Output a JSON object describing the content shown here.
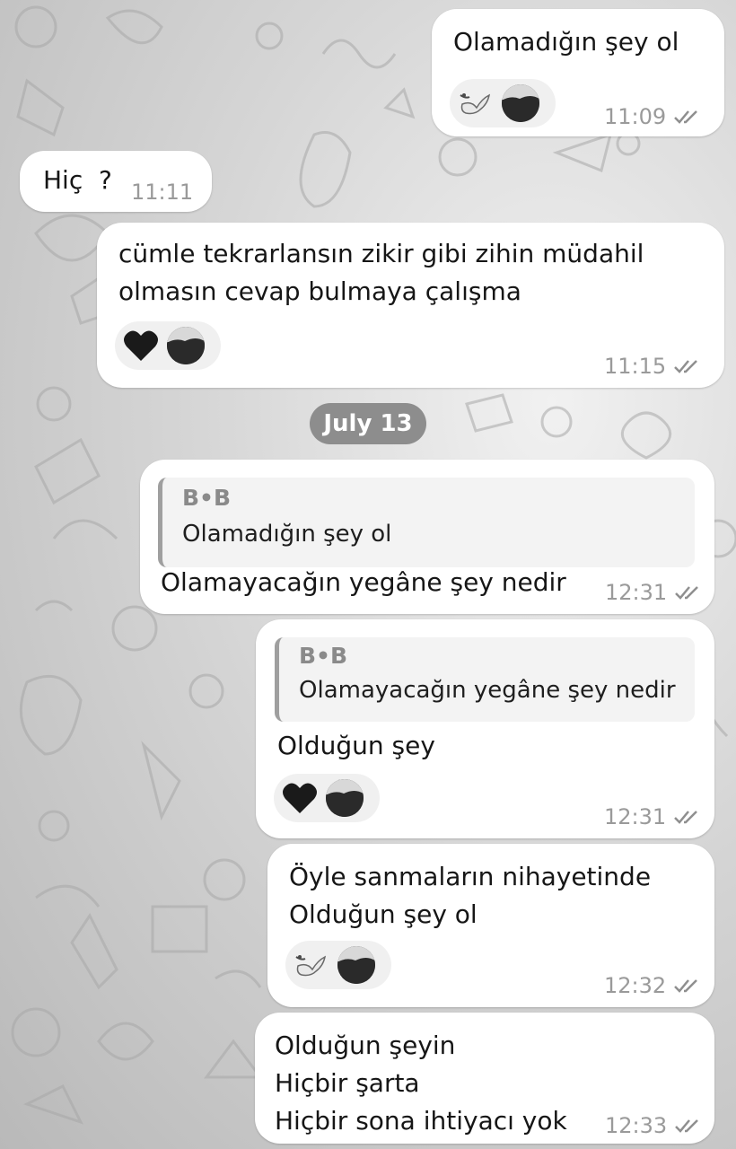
{
  "theme": {
    "bubble": "#ffffff",
    "muted_text": "#9a9a9a",
    "quote_bar": "#9f9f9f",
    "date_chip": "#8d8d8d"
  },
  "messages": [
    {
      "text": "Olamadığın şey ol",
      "time": "11:09",
      "reactions": [
        "dove-icon",
        "avatar"
      ],
      "status": "read"
    },
    {
      "text": "Hiç  ?",
      "time": "11:11"
    },
    {
      "text": "cümle tekrarlansın zikir gibi zihin müdahil\nolmasın cevap bulmaya çalışma",
      "time": "11:15",
      "reactions": [
        "black-heart-icon",
        "avatar"
      ],
      "status": "read"
    },
    {
      "reply_to": {
        "name": "B•B",
        "text": "Olamadığın şey ol"
      },
      "text": "Olamayacağın yegâne şey nedir",
      "time": "12:31",
      "status": "read"
    },
    {
      "reply_to": {
        "name": "B•B",
        "text": "Olamayacağın yegâne şey nedir"
      },
      "text": "Olduğun şey",
      "time": "12:31",
      "reactions": [
        "black-heart-icon",
        "avatar"
      ],
      "status": "read"
    },
    {
      "text": "Öyle sanmaların nihayetinde\nOlduğun şey ol",
      "time": "12:32",
      "reactions": [
        "dove-icon",
        "avatar"
      ],
      "status": "read"
    },
    {
      "text": "Olduğun şeyin\nHiçbir şarta\nHiçbir sona ihtiyacı yok",
      "time": "12:33",
      "status": "read"
    }
  ],
  "date_separator": "July 13"
}
